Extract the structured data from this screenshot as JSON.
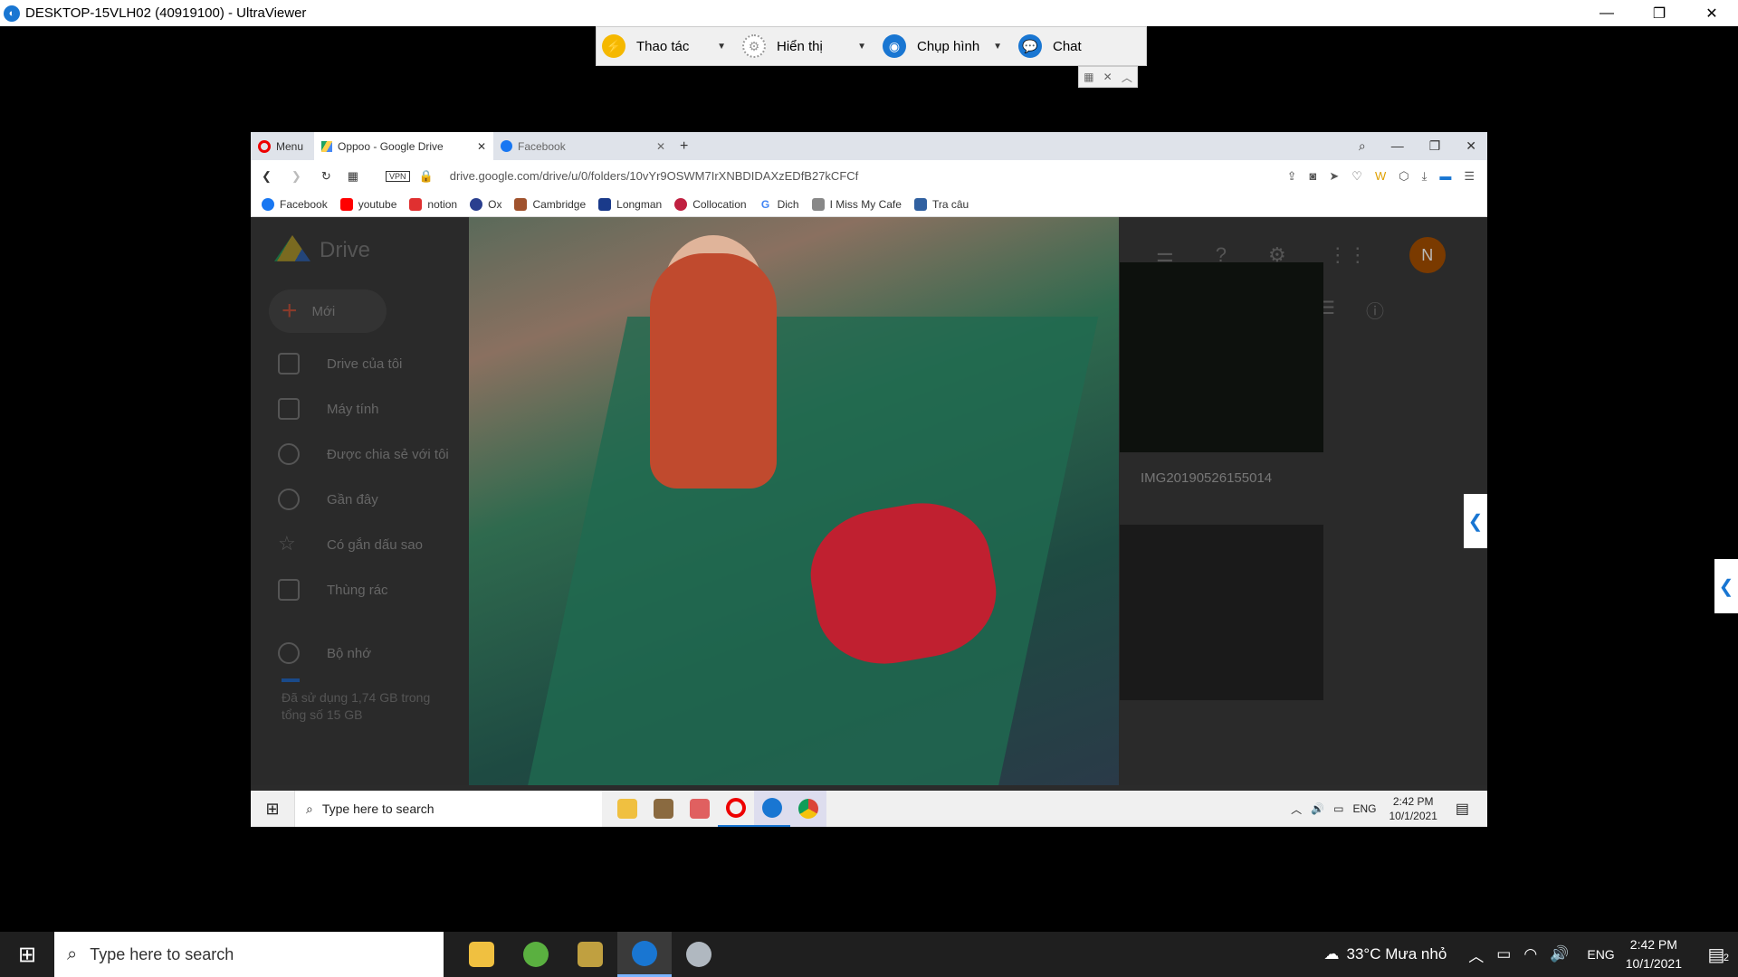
{
  "host_window": {
    "title": "DESKTOP-15VLH02 (40919100) - UltraViewer",
    "controls": [
      "—",
      "❐",
      "✕"
    ]
  },
  "uv_toolbar": {
    "items": [
      {
        "label": "Thao tác",
        "icon": "lightning-icon",
        "color": "#f5b800"
      },
      {
        "label": "Hiển thị",
        "icon": "gear-icon",
        "color": "#999999"
      },
      {
        "label": "Chụp hình",
        "icon": "camera-icon",
        "color": "#1976d2"
      },
      {
        "label": "Chat",
        "icon": "chat-icon",
        "color": "#1976d2"
      }
    ]
  },
  "browser": {
    "menu_label": "Menu",
    "tabs": [
      {
        "label": "Oppoo - Google Drive",
        "active": true
      },
      {
        "label": "Facebook",
        "active": false
      }
    ],
    "new_tab": "+",
    "url": "drive.google.com/drive/u/0/folders/10vYr9OSWM7IrXNBDIDAXzEDfB27kCFCf",
    "vpn_label": "VPN",
    "bookmarks": [
      {
        "label": "Facebook",
        "color": "#1877f2"
      },
      {
        "label": "youtube",
        "color": "#ff0000"
      },
      {
        "label": "notion",
        "color": "#e03030"
      },
      {
        "label": "Ox",
        "color": "#2a3f8f"
      },
      {
        "label": "Cambridge",
        "color": "#a0522d"
      },
      {
        "label": "Longman",
        "color": "#1a3a8a"
      },
      {
        "label": "Collocation",
        "color": "#c02040"
      },
      {
        "label": "Dich",
        "color": "#4285f4"
      },
      {
        "label": "I Miss My Cafe",
        "color": "#888888"
      },
      {
        "label": "Tra câu",
        "color": "#3060a0"
      }
    ]
  },
  "drive": {
    "logo": "Drive",
    "new_button": "Mới",
    "sidebar": [
      "Drive của tôi",
      "Máy tính",
      "Được chia sẻ với tôi",
      "Gần đây",
      "Có gắn dấu sao",
      "Thùng rác",
      "Bộ nhớ"
    ],
    "storage_text": "Đã sử dụng 1,74 GB trong tổng số 15 GB",
    "avatar_letter": "N",
    "thumb_label": "IMG20190526155014"
  },
  "remote_taskbar": {
    "search_placeholder": "Type here to search",
    "lang": "ENG",
    "time": "2:42 PM",
    "date": "10/1/2021"
  },
  "host_taskbar": {
    "search_placeholder": "Type here to search",
    "weather": "33°C  Mưa nhỏ",
    "lang": "ENG",
    "time": "2:42 PM",
    "date": "10/1/2021",
    "notif_count": "2"
  }
}
